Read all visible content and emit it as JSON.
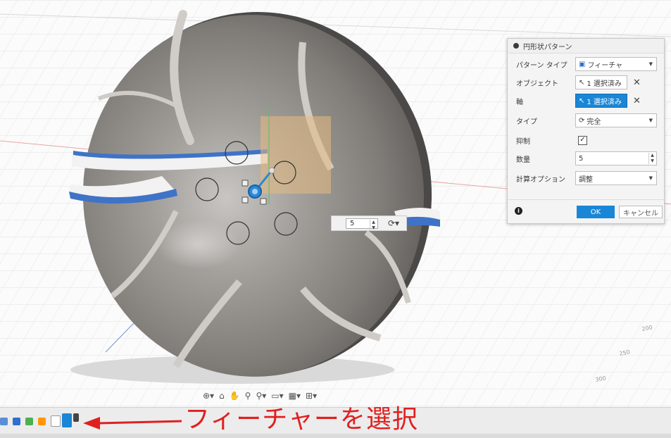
{
  "dialog": {
    "title": "円形状パターン",
    "rows": {
      "pattern_type": {
        "label": "パターン タイプ",
        "value": "フィーチャ"
      },
      "objects": {
        "label": "オブジェクト",
        "value": "1 選択済み"
      },
      "axis": {
        "label": "軸",
        "value": "1 選択済み"
      },
      "type": {
        "label": "タイプ",
        "value": "完全"
      },
      "suppress": {
        "label": "抑制",
        "checked": true
      },
      "quantity": {
        "label": "数量",
        "value": "5"
      },
      "compute": {
        "label": "計算オプション",
        "value": "調整"
      }
    },
    "ok_label": "OK",
    "cancel_label": "キャンセル"
  },
  "canvas": {
    "quantity_value": "5",
    "axis_ticks": [
      "200",
      "250",
      "300"
    ]
  },
  "caption": "フィーチャーを選択",
  "colors": {
    "accent": "#1a86d6",
    "annotation": "#e02020",
    "disc": "#8a8784"
  }
}
